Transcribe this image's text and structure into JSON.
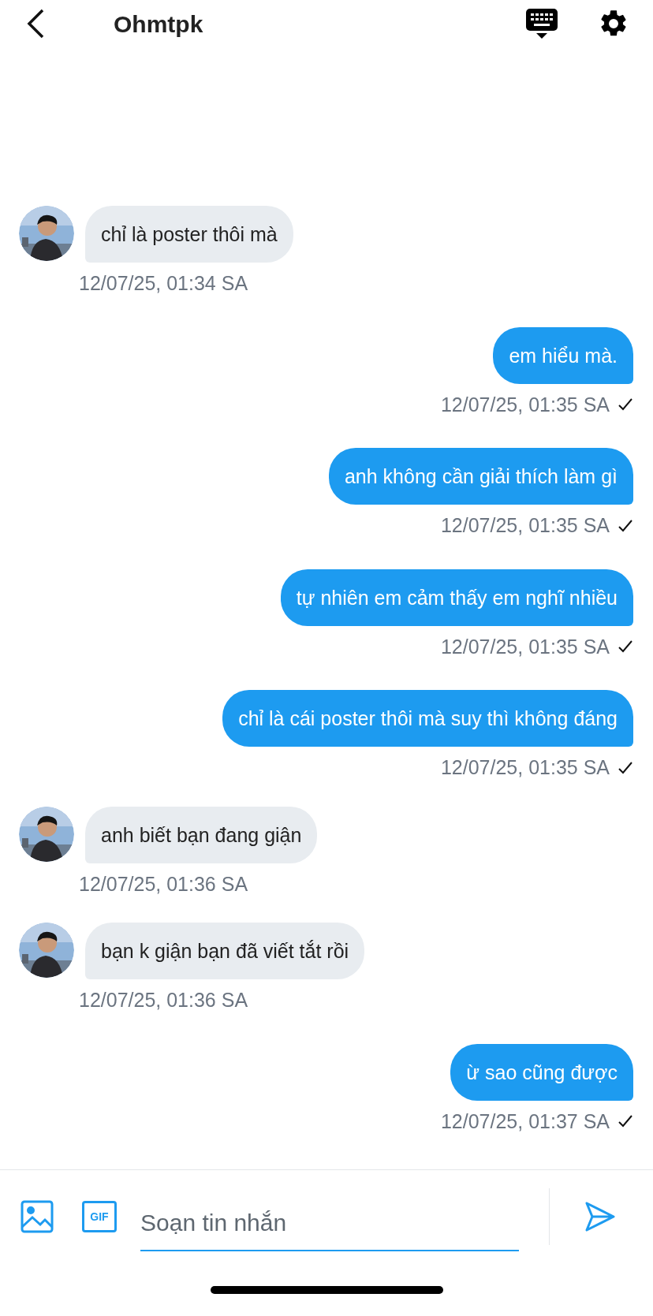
{
  "header": {
    "title": "Ohmtpk"
  },
  "messages": [
    {
      "kind": "incoming",
      "text": "chỉ là poster thôi mà",
      "time": "12/07/25, 01:34 SA"
    },
    {
      "kind": "outgoing",
      "text": "em hiểu mà.",
      "time": "12/07/25, 01:35 SA"
    },
    {
      "kind": "outgoing",
      "text": "anh không cần giải thích làm gì",
      "time": "12/07/25, 01:35 SA"
    },
    {
      "kind": "outgoing",
      "text": "tự nhiên em cảm thấy em nghĩ nhiều",
      "time": "12/07/25, 01:35 SA"
    },
    {
      "kind": "outgoing",
      "text": "chỉ là cái poster thôi mà suy thì không đáng",
      "time": "12/07/25, 01:35 SA"
    },
    {
      "kind": "incoming",
      "text": "anh biết bạn đang giận",
      "time": "12/07/25, 01:36 SA"
    },
    {
      "kind": "incoming",
      "text": "bạn k giận bạn đã viết tắt rồi",
      "time": "12/07/25, 01:36 SA"
    },
    {
      "kind": "outgoing",
      "text": "ừ sao cũng được",
      "time": "12/07/25, 01:37 SA"
    }
  ],
  "composer": {
    "gif_label": "GIF",
    "placeholder": "Soạn tin nhắn"
  }
}
